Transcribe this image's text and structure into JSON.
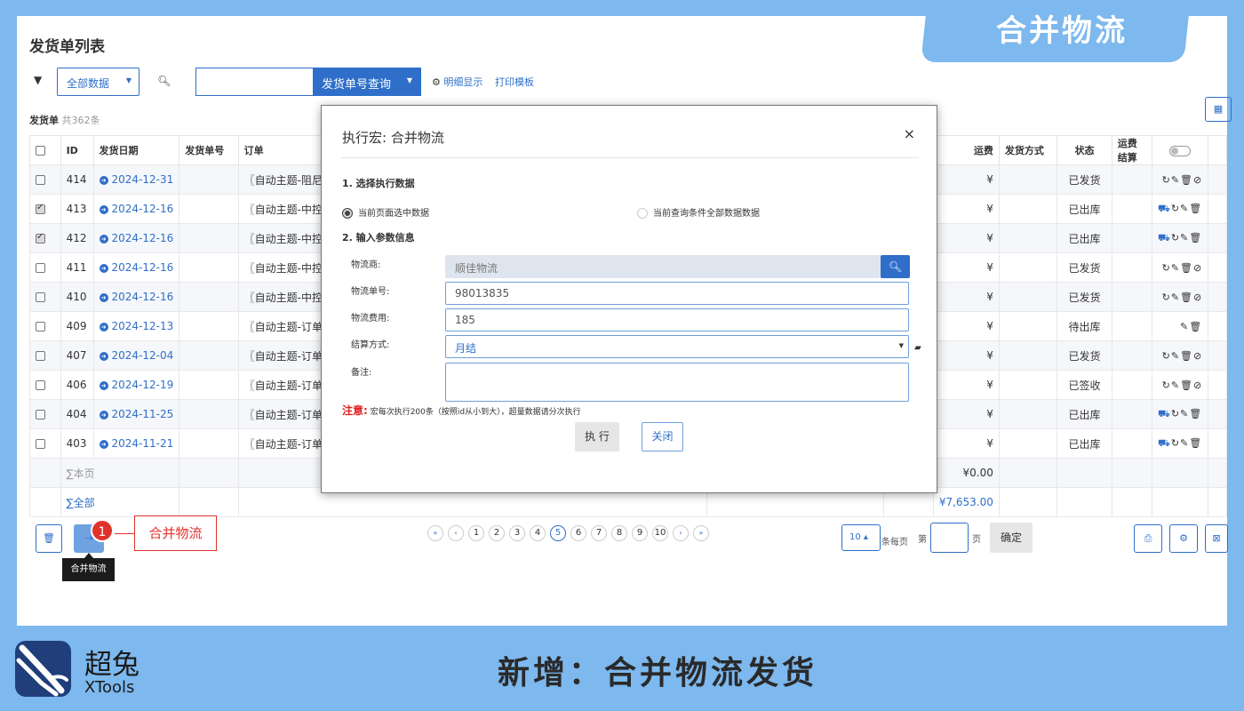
{
  "corner_tag": "合并物流",
  "page_title": "发货单列表",
  "toolbar": {
    "scope_select": "全部数据",
    "query_button": "发货单号查询",
    "detail_link": "明细显示",
    "print_link": "打印模板"
  },
  "count": {
    "label": "发货单",
    "total": "共362条"
  },
  "table": {
    "headers": {
      "id": "ID",
      "date": "发货日期",
      "no": "发货单号",
      "order": "订单",
      "freight": "运费",
      "method": "发货方式",
      "status": "状态",
      "settle": "运费结算"
    },
    "rows": [
      {
        "checked": false,
        "id": "414",
        "date": "2024-12-31",
        "order": "〖自动主题-阻尼弹",
        "freight": "¥",
        "status": "已发货",
        "ops": "↻✎🗑⊘"
      },
      {
        "checked": true,
        "id": "413",
        "date": "2024-12-16",
        "order": "〖自动主题-中控门",
        "freight": "¥",
        "status": "已出库",
        "ops": "⛟↻✎🗑"
      },
      {
        "checked": true,
        "id": "412",
        "date": "2024-12-16",
        "order": "〖自动主题-中控门",
        "freight": "¥",
        "status": "已出库",
        "ops": "⛟↻✎🗑"
      },
      {
        "checked": false,
        "id": "411",
        "date": "2024-12-16",
        "order": "〖自动主题-中控门",
        "freight": "¥",
        "status": "已发货",
        "ops": "↻✎🗑⊘"
      },
      {
        "checked": false,
        "id": "410",
        "date": "2024-12-16",
        "order": "〖自动主题-中控门",
        "freight": "¥",
        "status": "已发货",
        "ops": "↻✎🗑⊘"
      },
      {
        "checked": false,
        "id": "409",
        "date": "2024-12-13",
        "order": "〖自动主题-订单号",
        "freight": "¥",
        "status": "待出库",
        "ops": "✎🗑"
      },
      {
        "checked": false,
        "id": "407",
        "date": "2024-12-04",
        "order": "〖自动主题-订单号",
        "freight": "¥",
        "status": "已发货",
        "ops": "↻✎🗑⊘"
      },
      {
        "checked": false,
        "id": "406",
        "date": "2024-12-19",
        "order": "〖自动主题-订单号",
        "freight": "¥",
        "status": "已签收",
        "ops": "↻✎🗑⊘"
      },
      {
        "checked": false,
        "id": "404",
        "date": "2024-11-25",
        "order": "〖自动主题-订单号",
        "freight": "¥",
        "status": "已出库",
        "ops": "⛟↻✎🗑"
      },
      {
        "checked": false,
        "id": "403",
        "date": "2024-11-21",
        "order": "〖自动主题-订单号",
        "freight": "¥",
        "status": "已出库",
        "ops": "⛟↻✎🗑"
      }
    ],
    "sum_page_label": "∑本页",
    "sum_page_value": "¥0.00",
    "sum_all_label": "∑全部",
    "sum_all_value": "¥7,653.00"
  },
  "modal": {
    "title": "执行宏: 合并物流",
    "close": "×",
    "section1": "1. 选择执行数据",
    "radio_selected": "当前页面选中数据",
    "radio_all": "当前查询条件全部数据数据",
    "section2": "2. 输入参数信息",
    "fields": {
      "carrier_label": "物流商:",
      "carrier_value": "顺佳物流",
      "tracking_label": "物流单号:",
      "tracking_value": "98013835",
      "fee_label": "物流费用:",
      "fee_value": "185",
      "settle_label": "结算方式:",
      "settle_value": "月结",
      "remark_label": "备注:"
    },
    "note_label": "注意:",
    "note_text": "宏每次执行200条（按照id从小到大），超量数据请分次执行",
    "exec_button": "执 行",
    "close_button": "关闭"
  },
  "footer": {
    "badge": "1",
    "callout": "合并物流",
    "tooltip": "合并物流",
    "pages": [
      "1",
      "2",
      "3",
      "4",
      "5",
      "6",
      "7",
      "8",
      "9",
      "10"
    ],
    "current_page": "5",
    "per_page": "10",
    "per_page_label": "条每页",
    "page_prefix": "第",
    "page_suffix": "页",
    "confirm": "确定"
  },
  "branding": {
    "name_cn": "超兔",
    "name_en": "XTools",
    "headline": "新增：合并物流发货"
  }
}
